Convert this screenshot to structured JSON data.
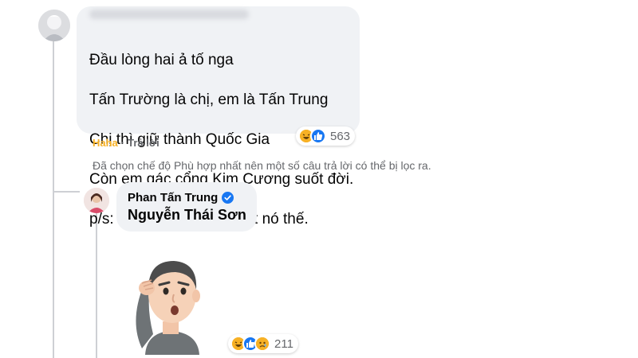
{
  "comment": {
    "author_name_hidden": true,
    "text_lines": [
      "Đầu lòng hai ả tố nga",
      "Tấn Trường là chị, em là Tấn Trung",
      "Chị thì giữ thành Quốc Gia",
      "Còn em gác cổng Kim Cương suốt đời.",
      "p/s: xl abe nhưng sự thật nó thế."
    ],
    "reactions": {
      "icons": [
        "haha-icon",
        "like-icon"
      ],
      "count": "563"
    },
    "action_reacted": "Haha",
    "action_separator": "·",
    "action_reply": "Trả lời"
  },
  "filter_note": "Đã chọn chế độ Phù hợp nhất nên một số câu trả lời có thể bị lọc ra.",
  "reply": {
    "author_name": "Phan Tấn Trung",
    "verified": true,
    "tagged_name": "Nguyễn Thái Sơn",
    "sticker": "thinking-avatar-sticker",
    "reactions": {
      "icons": [
        "haha-icon",
        "like-icon",
        "sad-icon"
      ],
      "count": "211"
    }
  },
  "colors": {
    "bubble": "#f0f2f5",
    "meta_text": "#65676b",
    "haha": "#f7b125",
    "like": "#1877f2",
    "verified": "#1877f2"
  }
}
